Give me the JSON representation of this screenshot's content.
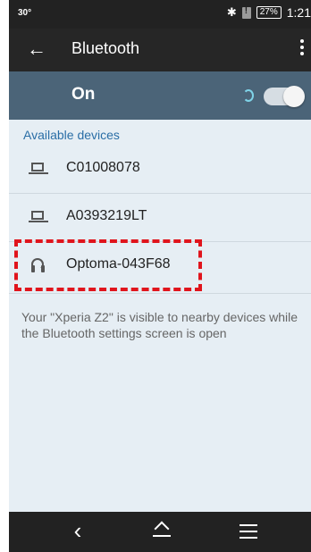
{
  "status_bar": {
    "left_text": "30°",
    "battery_percent": "27%",
    "time": "1:21",
    "icons": [
      "bluetooth-icon",
      "sim-alert-icon",
      "battery-icon"
    ]
  },
  "app_bar": {
    "title": "Bluetooth",
    "back_icon": "arrow-left-icon",
    "menu_icon": "more-vert-icon"
  },
  "master_switch": {
    "label": "On",
    "state": "on",
    "searching": true,
    "accent": "#7fd3e8"
  },
  "available_devices": {
    "header": "Available devices",
    "items": [
      {
        "name": "C01008078",
        "icon": "laptop-icon"
      },
      {
        "name": "A0393219LT",
        "icon": "laptop-icon"
      },
      {
        "name": "Optoma-043F68",
        "icon": "headset-icon",
        "highlighted": true
      }
    ]
  },
  "info_text": "Your \"Xperia Z2\" is visible to nearby devices while the Bluetooth settings screen is open",
  "nav_bar": {
    "icons": [
      "nav-back-icon",
      "nav-home-icon",
      "nav-recent-apps-icon"
    ]
  },
  "colors": {
    "app_bar": "#262626",
    "switch_bar": "#4b6478",
    "background": "#e6eef4",
    "section_header": "#2a6ea6",
    "highlight": "#e0141c"
  }
}
